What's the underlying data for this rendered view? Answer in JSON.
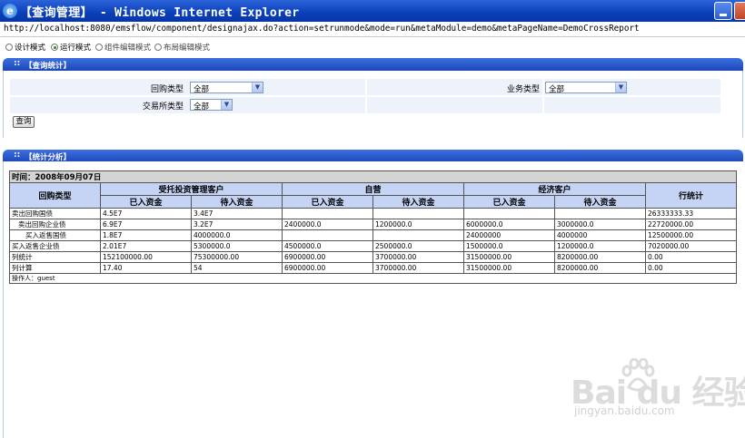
{
  "window": {
    "title": "【查询管理】 - Windows Internet Explorer",
    "address": "http://localhost:8080/emsflow/component/designajax.do?action=setrunmode&mode=run&metaModule=demo&metaPageName=DemoCrossReport"
  },
  "modes": [
    {
      "label": "设计模式",
      "checked": false
    },
    {
      "label": "运行模式",
      "checked": true
    },
    {
      "label": "组件编辑模式",
      "checked": false
    },
    {
      "label": "布局编辑模式",
      "checked": false
    }
  ],
  "query_panel": {
    "title": "【查询统计】",
    "fields": {
      "repo_type": {
        "label": "回购类型",
        "value": "全部"
      },
      "business_type": {
        "label": "业务类型",
        "value": "全部"
      },
      "exchange_type": {
        "label": "交易所类型",
        "value": "全部"
      }
    },
    "query_button": "查询"
  },
  "stats_panel": {
    "title": "【统计分析】",
    "time_label": "时间：2008年09月07日",
    "headers": {
      "row_header": "回购类型",
      "groups": [
        "受托投资管理客户",
        "自营",
        "经济客户"
      ],
      "sub": [
        "已入资金",
        "待入资金",
        "已入资金",
        "待入资金",
        "已入资金",
        "待入资金"
      ],
      "row_total": "行统计"
    },
    "rows": [
      {
        "name": "卖出回购国债",
        "indent": 0,
        "cells": [
          "4.5E7",
          "3.4E7",
          "",
          "",
          "",
          "",
          "26333333.33"
        ]
      },
      {
        "name": "卖出回购企业债",
        "indent": 1,
        "cells": [
          "6.9E7",
          "3.2E7",
          "2400000.0",
          "1200000.0",
          "6000000.0",
          "3000000.0",
          "22720000.00"
        ]
      },
      {
        "name": "买入返售国债",
        "indent": 2,
        "cells": [
          "1.8E7",
          "4000000.0",
          "",
          "",
          "24000000",
          "4000000",
          "12500000.00"
        ]
      },
      {
        "name": "买入返售企业债",
        "indent": 0,
        "cells": [
          "2.01E7",
          "5300000.0",
          "4500000.0",
          "2500000.0",
          "1500000.0",
          "1200000.0",
          "7020000.00"
        ]
      },
      {
        "name": "列统计",
        "indent": 0,
        "cells": [
          "152100000.00",
          "75300000.00",
          "6900000.00",
          "3700000.00",
          "31500000.00",
          "8200000.00",
          "0.00"
        ]
      },
      {
        "name": "列计算",
        "indent": 0,
        "cells": [
          "17.40",
          "54",
          "6900000.00",
          "3700000.00",
          "31500000.00",
          "8200000.00",
          "0.00"
        ]
      }
    ],
    "operator": "操作人：guest"
  },
  "watermark": {
    "text": "Bai du 经验",
    "url": "jingyan.baidu.com"
  }
}
